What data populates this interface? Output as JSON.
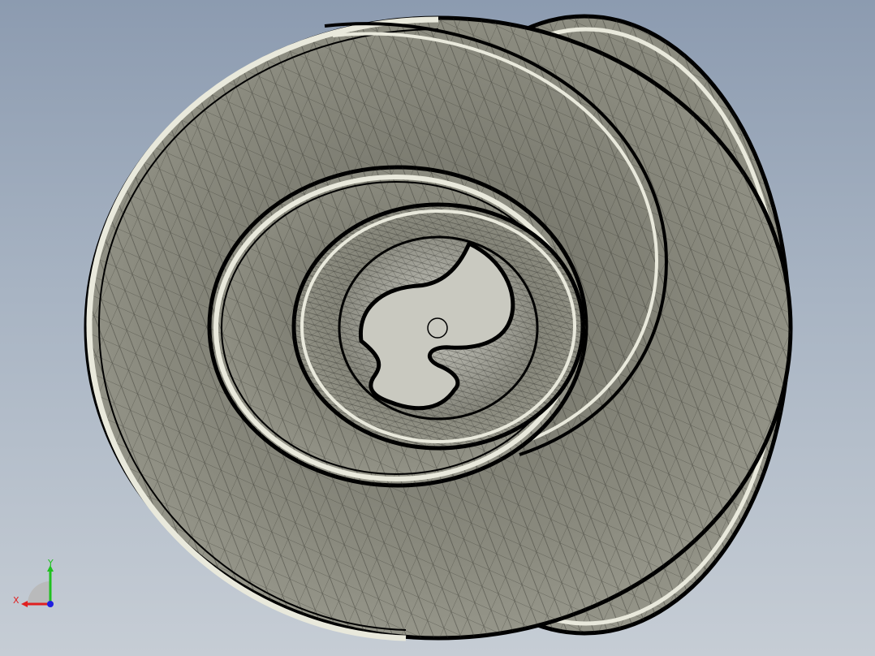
{
  "viewport": {
    "background_top": "#8c9bb0",
    "background_bottom": "#c6cdd5"
  },
  "model": {
    "name": "scroll-spiral-part",
    "shading": "shaded-with-mesh-edges",
    "surface_color": "#858579",
    "edge_color": "#000000",
    "rim_color": "#e9e9dc"
  },
  "triad": {
    "x_label": "X",
    "y_label": "Y",
    "x_color": "#e02020",
    "y_color": "#20c020",
    "z_color": "#2020e0"
  }
}
